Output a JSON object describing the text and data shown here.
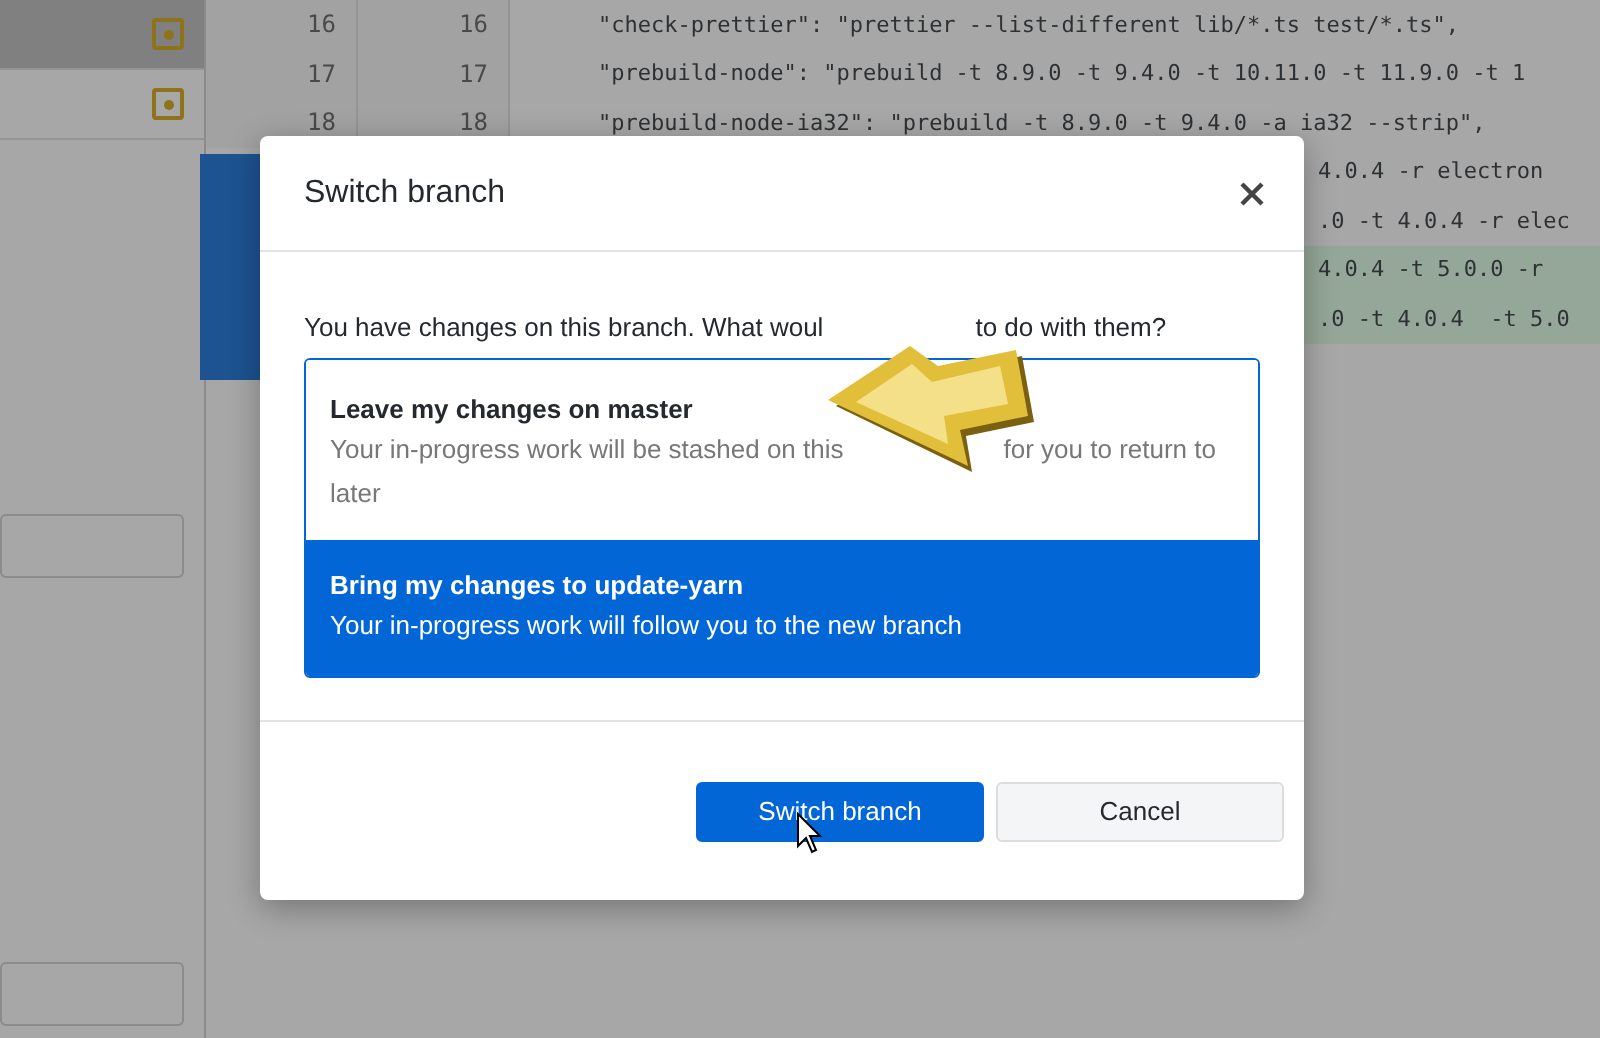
{
  "sidebar": {
    "items": [
      {
        "modified": true,
        "selected": true
      },
      {
        "modified": true,
        "selected": false
      }
    ]
  },
  "diff": {
    "lines": [
      {
        "kind": "full",
        "old": "16",
        "new": "16",
        "text": "\"check-prettier\": \"prettier --list-different lib/*.ts test/*.ts\",",
        "added": false
      },
      {
        "kind": "full",
        "old": "17",
        "new": "17",
        "text": "\"prebuild-node\": \"prebuild -t 8.9.0 -t 9.4.0 -t 10.11.0 -t 11.9.0 -t 1",
        "added": false
      },
      {
        "kind": "full",
        "old": "18",
        "new": "18",
        "text": "\"prebuild-node-ia32\": \"prebuild -t 8.9.0 -t 9.4.0 -a ia32 --strip\",",
        "added": false
      },
      {
        "kind": "partial",
        "text": "4.0.4 -r electron",
        "added": false
      },
      {
        "kind": "partial",
        "text": ".0 -t 4.0.4 -r elec",
        "added": false
      },
      {
        "kind": "partial",
        "text": "4.0.4 -t 5.0.0 -r",
        "added": true
      },
      {
        "kind": "partial",
        "text": ".0 -t 4.0.4  -t 5.0",
        "added": true
      }
    ]
  },
  "dialog": {
    "title": "Switch branch",
    "prompt_parts": [
      "You have changes on this branch. What woul",
      "to do with them?"
    ],
    "options": [
      {
        "title": "Leave my changes on master",
        "description_parts": [
          "Your in-progress work will be stashed on this",
          "for you to return to",
          "later"
        ],
        "selected": false
      },
      {
        "title": "Bring my changes to update-yarn",
        "description_parts": [
          "Your in-progress work will follow you to the new branch"
        ],
        "selected": true
      }
    ],
    "buttons": [
      {
        "label": "Switch branch",
        "kind": "primary"
      },
      {
        "label": "Cancel",
        "kind": "secondary"
      }
    ]
  }
}
